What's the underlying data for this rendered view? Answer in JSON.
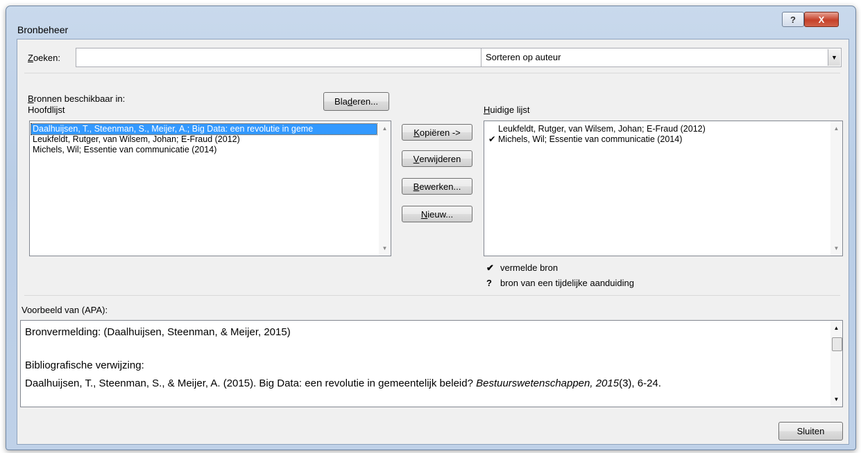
{
  "window": {
    "title": "Bronbeheer",
    "help_label": "?",
    "close_label": "X"
  },
  "search": {
    "label_first": "Z",
    "label_rest": "oeken:",
    "value": ""
  },
  "sort": {
    "selected": "Sorteren op auteur"
  },
  "sources": {
    "available_in_b": "B",
    "available_in_rest": "ronnen beschikbaar in:",
    "master_list": "Hoofdlijst",
    "browse_pre": "Bla",
    "browse_u": "d",
    "browse_post": "eren...",
    "items": [
      "Daalhuijsen, T., Steenman, S., Meijer, A.; Big Data: een revolutie in geme",
      "Leukfeldt, Rutger, van Wilsem, Johan; E-Fraud (2012)",
      "Michels, Wil; Essentie van communicatie (2014)"
    ]
  },
  "actions": {
    "copy_u": "K",
    "copy_rest": "opiëren ->",
    "delete_u": "V",
    "delete_rest": "erwijderen",
    "edit_u": "B",
    "edit_rest": "ewerken...",
    "new_u": "N",
    "new_rest": "ieuw..."
  },
  "current": {
    "label_u": "H",
    "label_rest": "uidige lijst",
    "items": [
      {
        "mark": "",
        "text": "Leukfeldt, Rutger, van Wilsem, Johan; E-Fraud (2012)"
      },
      {
        "mark": "✔",
        "text": "Michels, Wil; Essentie van communicatie (2014)"
      }
    ]
  },
  "legend": {
    "cited_mark": "✔",
    "cited_text": "vermelde bron",
    "placeholder_mark": "?",
    "placeholder_text": "bron van een tijdelijke aanduiding"
  },
  "preview": {
    "label": "Voorbeeld van (APA):",
    "citation": "Bronvermelding:  (Daalhuijsen, Steenman, & Meijer, 2015)",
    "bib_heading": "Bibliografische verwijzing:",
    "bib_plain": "Daalhuijsen, T., Steenman, S., & Meijer, A. (2015). Big Data: een revolutie in gemeentelijk beleid? ",
    "bib_italic": "Bestuurswetenschappen, 2015",
    "bib_tail": "(3), 6-24."
  },
  "footer": {
    "close_label": "Sluiten"
  }
}
